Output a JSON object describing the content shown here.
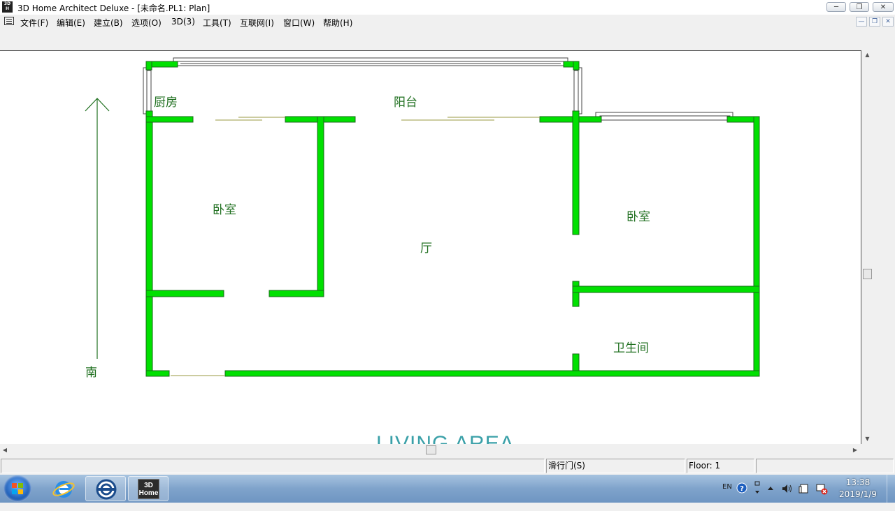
{
  "window": {
    "title": "3D Home Architect Deluxe - [未命名.PL1: Plan]",
    "app_icon": "3D-Home-icon",
    "app_icon_text": "3D Home",
    "controls": {
      "minimize": "minimize-icon",
      "restore": "restore-icon",
      "close": "close-icon"
    }
  },
  "menubar": {
    "items": [
      "文件(F)",
      "编辑(E)",
      "建立(B)",
      "选项(O)",
      "3D(3)",
      "工具(T)",
      "互联网(I)",
      "窗口(W)",
      "帮助(H)"
    ],
    "mdi_controls": [
      "minimize-icon",
      "restore-icon",
      "close-icon"
    ]
  },
  "plan": {
    "room_labels": [
      "厨房",
      "阳台",
      "卧室",
      "厅",
      "卧室",
      "卫生间"
    ],
    "compass_label": "南",
    "section_title": "LIVING AREA",
    "wall_color": "#00e000",
    "text_color": "#207020",
    "title_color": "#3aa0a8"
  },
  "statusbar": {
    "message": "",
    "tool": "滑行门(S)",
    "floor": "Floor: 1",
    "extra": ""
  },
  "taskbar": {
    "start": "windows-logo-icon",
    "apps": [
      "internet-explorer-icon",
      "app-circle-icon",
      "3D-Home-icon"
    ],
    "active_app_text": "3D Home",
    "tray": {
      "lang": "EN",
      "time": "13:38",
      "date": "2019/1/9"
    }
  }
}
